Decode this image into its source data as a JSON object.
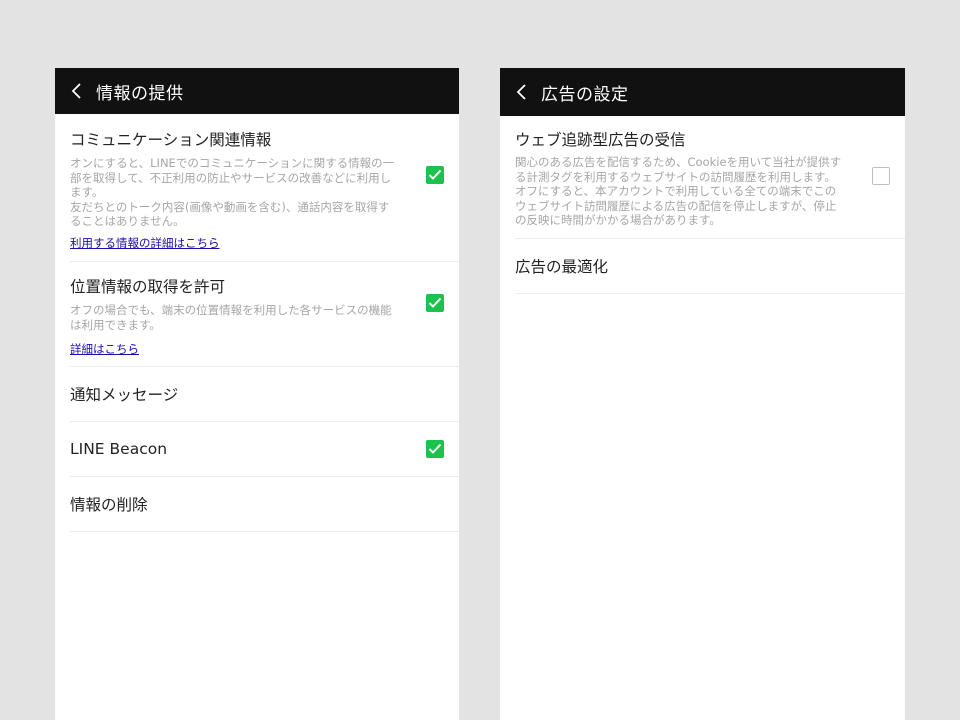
{
  "left_screen": {
    "header": {
      "title": "情報の提供",
      "back_icon": "chevron-left-icon"
    },
    "communication": {
      "title": "コミュニケーション関連情報",
      "description": "オンにすると、LINEでのコミュニケーションに関する情報の一\n部を取得して、不正利用の防止やサービスの改善などに利用し\nます。\n友だちとのトーク内容(画像や動画を含む)、通話内容を取得す\nることはありません。",
      "link": "利用する情報の詳細はこちら",
      "checked": true
    },
    "location": {
      "title": "位置情報の取得を許可",
      "description": "オフの場合でも、端末の位置情報を利用した各サービスの機能\nは利用できます。",
      "link": "詳細はこちら",
      "checked": true
    },
    "notification": {
      "title": "通知メッセージ"
    },
    "beacon": {
      "title": "LINE Beacon",
      "checked": true
    },
    "delete": {
      "title": "情報の削除"
    }
  },
  "right_screen": {
    "header": {
      "title": "広告の設定",
      "back_icon": "chevron-left-icon"
    },
    "tracking": {
      "title": "ウェブ追跡型広告の受信",
      "description": "関心のある広告を配信するため、Cookieを用いて当社が提供す\nる計測タグを利用するウェブサイトの訪問履歴を利用します。\nオフにすると、本アカウントで利用している全ての端末でこの\nウェブサイト訪問履歴による広告の配信を停止しますが、停止\nの反映に時間がかかる場合があります。",
      "checked": false
    },
    "optimize": {
      "title": "広告の最適化"
    }
  },
  "colors": {
    "header_bg": "#111111",
    "checkbox_on": "#1dc14d",
    "link": "#1a0dab",
    "background": "#e3e3e3"
  }
}
